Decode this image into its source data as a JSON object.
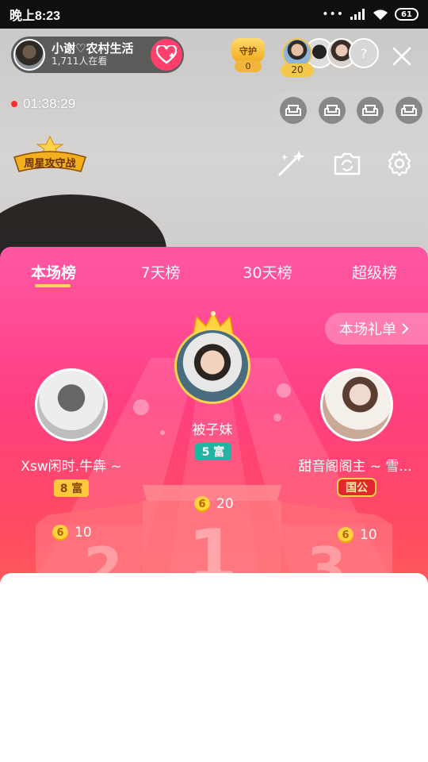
{
  "status_bar": {
    "time": "晚上8:23",
    "signal_dots": "•••",
    "battery": "61"
  },
  "host": {
    "name": "小谢♡农村生活",
    "viewers": "1,711人在看"
  },
  "guard": {
    "label": "守护",
    "count": "0"
  },
  "top_viewer_badge": "20",
  "stream": {
    "elapsed": "01:38:29"
  },
  "week_star_badge": "周星攻守战",
  "leaderboard": {
    "tabs": [
      "本场榜",
      "7天榜",
      "30天榜",
      "超级榜"
    ],
    "gift_list_link": "本场礼单",
    "podium": {
      "first": {
        "name": "被子妹",
        "level": "5 富",
        "coins": "20"
      },
      "second": {
        "name": "Xsw闲时.牛犇 ~",
        "level": "8 富",
        "coins": "10"
      },
      "third": {
        "name": "甜音阁阁主 ~ 雪...",
        "level": "国公",
        "coins": "10"
      }
    },
    "podium_numbers": [
      "2",
      "1",
      "3"
    ]
  },
  "colors": {
    "accent_pink": "#ff4f8a",
    "follow_button": "#ff3f6c",
    "tab_indicator": "#ffd65a",
    "coin": "#ffd23f"
  },
  "icons": {
    "follow": "heart-plus-icon",
    "close": "close-icon",
    "seat": "sofa-icon",
    "magic": "magic-wand-icon",
    "camera": "camera-switch-icon",
    "settings": "gear-icon",
    "coin": "coin-icon"
  }
}
